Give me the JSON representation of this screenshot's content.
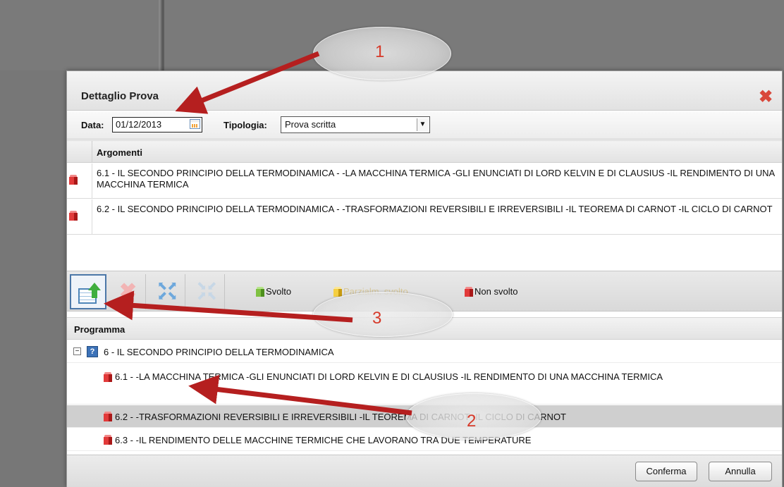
{
  "dialog": {
    "title": "Dettaglio Prova"
  },
  "filters": {
    "data_label": "Data:",
    "data_value": "01/12/2013",
    "tipologia_label": "Tipologia:",
    "tipologia_value": "Prova scritta"
  },
  "argomenti": {
    "header": "Argomenti",
    "rows": [
      {
        "status_icon": "red-cube-icon",
        "text": "6.1 - IL SECONDO PRINCIPIO DELLA TERMODINAMICA - -LA MACCHINA TERMICA -GLI ENUNCIATI DI LORD KELVIN E DI CLAUSIUS -IL RENDIMENTO DI UNA MACCHINA TERMICA"
      },
      {
        "status_icon": "red-cube-icon",
        "text": "6.2 - IL SECONDO PRINCIPIO DELLA TERMODINAMICA - -TRASFORMAZIONI REVERSIBILI E IRREVERSIBILI -IL TEOREMA DI CARNOT -IL CICLO DI CARNOT"
      }
    ]
  },
  "toolbar": {
    "legend": [
      {
        "label": "Svolto",
        "icon": "green-cube-icon"
      },
      {
        "label": "Parzialm. svolto",
        "icon": "yellow-cube-icon"
      },
      {
        "label": "Non svolto",
        "icon": "red-cube-icon"
      }
    ]
  },
  "programma": {
    "header": "Programma",
    "root": {
      "toggle": "⊟",
      "badge": "?",
      "text": "6 - IL SECONDO PRINCIPIO DELLA TERMODINAMICA"
    },
    "items": [
      {
        "text": "6.1 - -LA MACCHINA TERMICA -GLI ENUNCIATI DI LORD KELVIN E DI CLAUSIUS -IL RENDIMENTO DI UNA MACCHINA TERMICA",
        "selected": false
      },
      {
        "text": "6.2 - -TRASFORMAZIONI REVERSIBILI E IRREVERSIBILI -IL TEOREMA DI CARNOT -IL CICLO DI CARNOT",
        "selected": true
      },
      {
        "text": "6.3 - -IL RENDIMENTO DELLE MACCHINE TERMICHE CHE LAVORANO TRA DUE TEMPERATURE",
        "selected": false
      }
    ]
  },
  "footer": {
    "confirm_label": "Conferma",
    "cancel_label": "Annulla"
  },
  "annotations": {
    "callouts": [
      "1",
      "2",
      "3"
    ],
    "color": "#d63a2a",
    "arrow_color": "#b51f1f"
  },
  "colors": {
    "close": "#d9473a",
    "selected_row": "#cfcfcf"
  }
}
